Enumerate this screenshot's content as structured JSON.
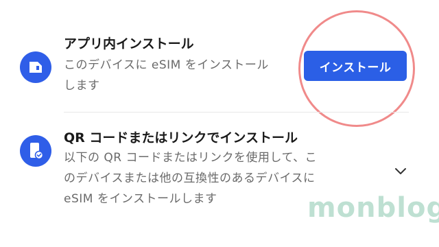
{
  "app_install": {
    "title": "アプリ内インストール",
    "desc_line1": "このデバイスに eSIM をインストール",
    "desc_line2": "します",
    "button_label": "インストール",
    "icon": "sim-card-icon"
  },
  "qr_install": {
    "title": "QR コードまたはリンクでインストール",
    "desc_line1": "以下の QR コードまたはリンクを使用して、こ",
    "desc_line2": "のデバイスまたは他の互換性のあるデバイスに",
    "desc_line3": "eSIM をインストールします",
    "icon": "phone-check-icon",
    "expand_icon": "chevron-down-icon"
  },
  "watermark": "monblog",
  "colors": {
    "accent": "#2b5fe6",
    "highlight_ring": "#f08a8a",
    "watermark": "#a9d6c3"
  }
}
